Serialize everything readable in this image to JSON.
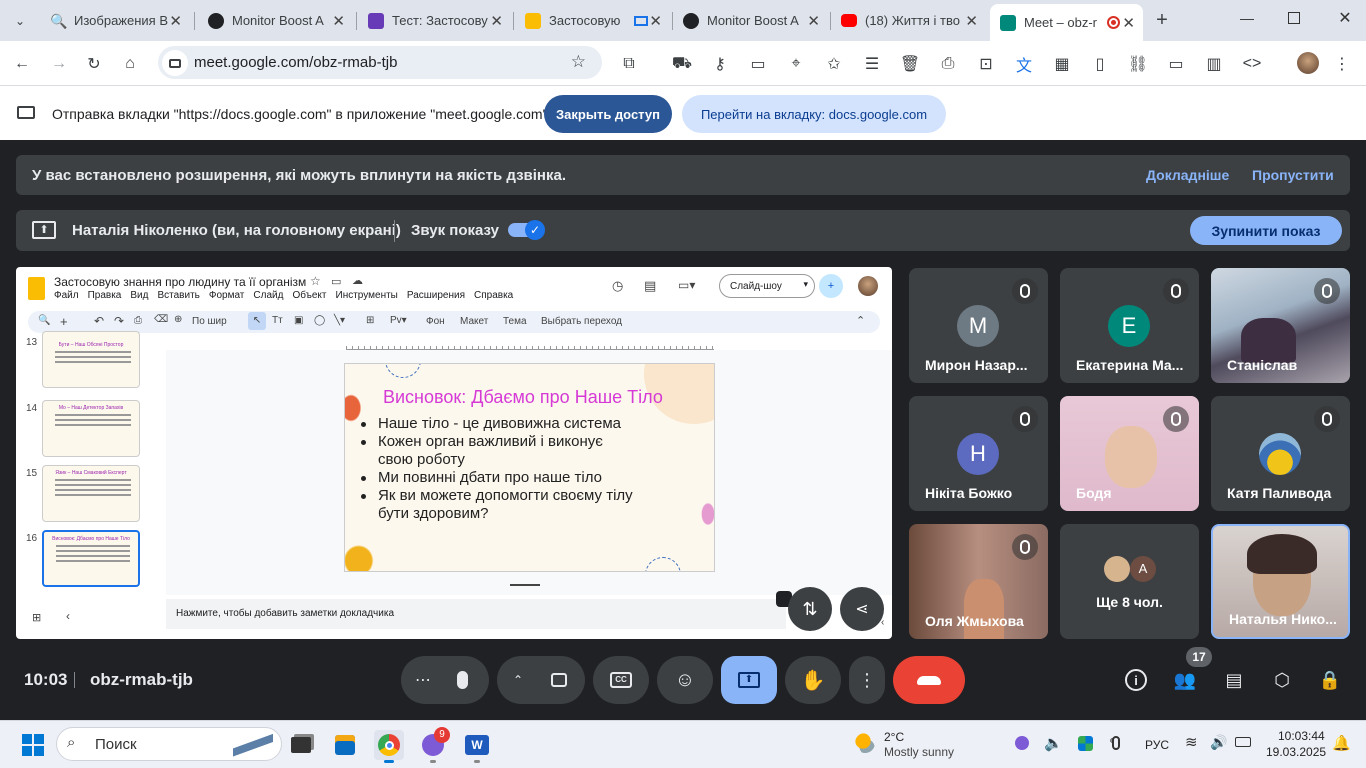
{
  "tabs": [
    {
      "label": "Изображения В",
      "active": false,
      "color": "#1a73e8"
    },
    {
      "label": "Monitor Boost A",
      "active": false,
      "color": "#202124"
    },
    {
      "label": "Тест: Застосову",
      "active": false,
      "color": "#673ab7"
    },
    {
      "label": "Застосовую",
      "active": false,
      "color": "#fbbc04"
    },
    {
      "label": "Monitor Boost A",
      "active": false,
      "color": "#202124"
    },
    {
      "label": "(18) Життя і тво",
      "active": false,
      "color": "#ff0000"
    },
    {
      "label": "Meet – obz-r",
      "active": true,
      "color": "#00897b"
    }
  ],
  "address": "meet.google.com/obz-rmab-tjb",
  "infobar": {
    "text": "Отправка вкладки \"https://docs.google.com\" в приложение \"meet.google.com\"...",
    "stop_label": "Закрыть доступ",
    "goto_label": "Перейти на вкладку: docs.google.com"
  },
  "ext_banner": {
    "text": "У вас встановлено розширення, які можуть вплинути на якість дзвінка.",
    "more": "Докладніше",
    "skip": "Пропустити"
  },
  "present_bar": {
    "presenter": "Наталія Ніколенко (ви, на головному екрані)",
    "sound_label": "Звук показу",
    "stop_label": "Зупинити показ"
  },
  "slides_app": {
    "title": "Застосовую знання про людину та її організм",
    "menu": [
      "Файл",
      "Правка",
      "Вид",
      "Вставить",
      "Формат",
      "Слайд",
      "Объект",
      "Инструменты",
      "Расширения",
      "Справка"
    ],
    "slideshow_label": "Слайд-шоу",
    "toolbar": {
      "zoom": "По шир",
      "bg": "Фон",
      "layout": "Макет",
      "theme": "Тема",
      "transition": "Выбрать переход"
    },
    "thumbs": [
      {
        "num": "13",
        "title": "Бути – Наш Обсяні Простор"
      },
      {
        "num": "14",
        "title": "Мо – Наш Детектор Запахів"
      },
      {
        "num": "15",
        "title": "Язик – Наш Смаковий Експерт"
      },
      {
        "num": "16",
        "title": "Висновок: Дбаємо про Наше Тіло"
      }
    ],
    "slide": {
      "title": "Висновок: Дбаємо про Наше Тіло",
      "bullets": [
        "Наше тіло - це дивовижна система",
        "Кожен орган важливий і виконує своюроботу",
        "Ми повинні дбати про наше тіло",
        "Як ви можете допомогти своєму тілу бути здоровим?"
      ]
    },
    "bullet_lines": [
      [
        "Наше тіло - це дивовижна система"
      ],
      [
        "Кожен орган важливий і виконує",
        "свою роботу"
      ],
      [
        "Ми повинні дбати про наше тіло"
      ],
      [
        "Як ви можете допомогти своєму тілу",
        "бути здоровим?"
      ]
    ],
    "notes_placeholder": "Нажмите, чтобы добавить заметки докладчика"
  },
  "participants": [
    {
      "name": "Мирон Назар...",
      "initial": "М",
      "avatar_color": "#6d7a84"
    },
    {
      "name": "Екатерина Ма...",
      "initial": "Е",
      "avatar_color": "#00897b"
    },
    {
      "name": "Станіслав",
      "initial": "",
      "avatar_color": ""
    },
    {
      "name": "Нікіта Божко",
      "initial": "Н",
      "avatar_color": "#5c6bc0"
    },
    {
      "name": "Бодя",
      "initial": "",
      "avatar_color": ""
    },
    {
      "name": "Катя Паливода",
      "initial": "",
      "avatar_color": ""
    },
    {
      "name": "Оля Жмыхова",
      "initial": "",
      "avatar_color": ""
    },
    {
      "name": "Ще 8 чол.",
      "initial": "A",
      "avatar_color": "#6d4c41"
    },
    {
      "name": "Наталья Нико...",
      "initial": "",
      "avatar_color": ""
    }
  ],
  "bottom_bar": {
    "time": "10:03",
    "code": "obz-rmab-tjb",
    "people_count": "17"
  },
  "taskbar": {
    "search_placeholder": "Поиск",
    "weather_temp": "2°C",
    "weather_desc": "Mostly sunny",
    "lang": "РУС",
    "clock_time": "10:03:44",
    "clock_date": "19.03.2025",
    "notif_count": "9"
  }
}
